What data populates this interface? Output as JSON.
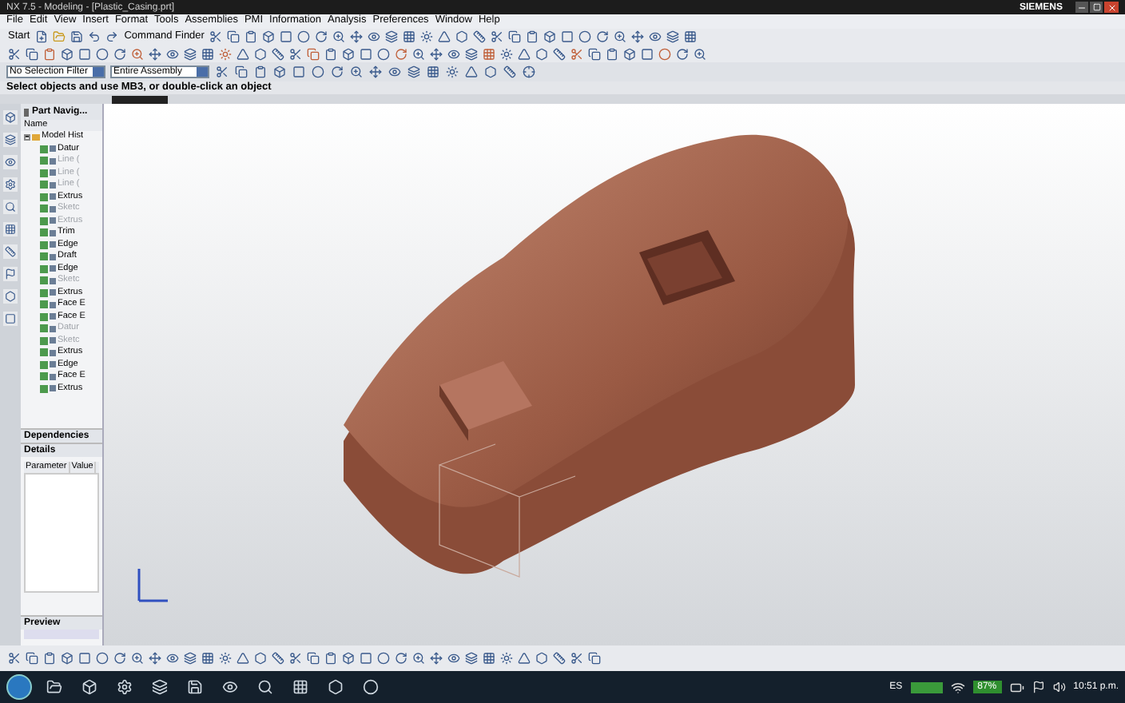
{
  "window": {
    "title": "NX 7.5 - Modeling - [Plastic_Casing.prt]",
    "brand": "SIEMENS"
  },
  "menu": [
    "File",
    "Edit",
    "View",
    "Insert",
    "Format",
    "Tools",
    "Assemblies",
    "PMI",
    "Information",
    "Analysis",
    "Preferences",
    "Window",
    "Help"
  ],
  "toolbar": {
    "start": "Start",
    "command_finder": "Command Finder"
  },
  "selection_bar": {
    "filter": "No Selection Filter",
    "scope": "Entire Assembly"
  },
  "cue_line": "Select objects and use MB3, or double-click an object",
  "navigator": {
    "title": "Part Navig...",
    "column": "Name",
    "root": {
      "label": "Model Hist",
      "expanded": true,
      "children": [
        {
          "label": "Datur",
          "dimmed": false
        },
        {
          "label": "Line (",
          "dimmed": true
        },
        {
          "label": "Line (",
          "dimmed": true
        },
        {
          "label": "Line (",
          "dimmed": true
        },
        {
          "label": "Extrus",
          "dimmed": false
        },
        {
          "label": "Sketc",
          "dimmed": true
        },
        {
          "label": "Extrus",
          "dimmed": true
        },
        {
          "label": "Trim",
          "dimmed": false
        },
        {
          "label": "Edge",
          "dimmed": false
        },
        {
          "label": "Draft",
          "dimmed": false
        },
        {
          "label": "Edge",
          "dimmed": false
        },
        {
          "label": "Sketc",
          "dimmed": true
        },
        {
          "label": "Extrus",
          "dimmed": false
        },
        {
          "label": "Face E",
          "dimmed": false
        },
        {
          "label": "Face E",
          "dimmed": false
        },
        {
          "label": "Datur",
          "dimmed": true
        },
        {
          "label": "Sketc",
          "dimmed": true
        },
        {
          "label": "Extrus",
          "dimmed": false
        },
        {
          "label": "Edge",
          "dimmed": false
        },
        {
          "label": "Face E",
          "dimmed": false
        },
        {
          "label": "Extrus",
          "dimmed": false
        }
      ]
    }
  },
  "dependencies": {
    "title": "Dependencies"
  },
  "details": {
    "title": "Details",
    "columns": [
      "Parameter",
      "Value"
    ]
  },
  "preview": {
    "title": "Preview"
  },
  "taskbar": {
    "language": "ES",
    "battery": "87%",
    "time": "10:51 p.m."
  }
}
